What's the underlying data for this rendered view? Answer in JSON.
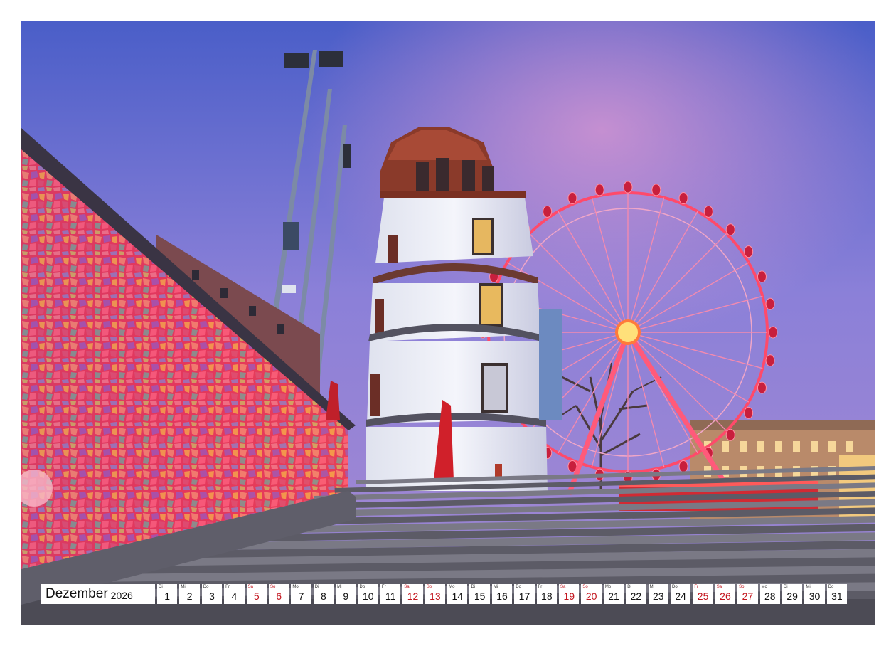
{
  "calendar": {
    "month": "Dezember",
    "year": "2026",
    "days": [
      {
        "dow": "Di",
        "num": "1",
        "red": false
      },
      {
        "dow": "Mi",
        "num": "2",
        "red": false
      },
      {
        "dow": "Do",
        "num": "3",
        "red": false
      },
      {
        "dow": "Fr",
        "num": "4",
        "red": false
      },
      {
        "dow": "Sa",
        "num": "5",
        "red": true
      },
      {
        "dow": "So",
        "num": "6",
        "red": true
      },
      {
        "dow": "Mo",
        "num": "7",
        "red": false
      },
      {
        "dow": "Di",
        "num": "8",
        "red": false
      },
      {
        "dow": "Mi",
        "num": "9",
        "red": false
      },
      {
        "dow": "Do",
        "num": "10",
        "red": false
      },
      {
        "dow": "Fr",
        "num": "11",
        "red": false
      },
      {
        "dow": "Sa",
        "num": "12",
        "red": true
      },
      {
        "dow": "So",
        "num": "13",
        "red": true
      },
      {
        "dow": "Mo",
        "num": "14",
        "red": false
      },
      {
        "dow": "Di",
        "num": "15",
        "red": false
      },
      {
        "dow": "Mi",
        "num": "16",
        "red": false
      },
      {
        "dow": "Do",
        "num": "17",
        "red": false
      },
      {
        "dow": "Fr",
        "num": "18",
        "red": false
      },
      {
        "dow": "Sa",
        "num": "19",
        "red": true
      },
      {
        "dow": "So",
        "num": "20",
        "red": true
      },
      {
        "dow": "Mo",
        "num": "21",
        "red": false
      },
      {
        "dow": "Di",
        "num": "22",
        "red": false
      },
      {
        "dow": "Mi",
        "num": "23",
        "red": false
      },
      {
        "dow": "Do",
        "num": "24",
        "red": false
      },
      {
        "dow": "Fr",
        "num": "25",
        "red": true
      },
      {
        "dow": "Sa",
        "num": "26",
        "red": true
      },
      {
        "dow": "So",
        "num": "27",
        "red": true
      },
      {
        "dow": "Mo",
        "num": "28",
        "red": false
      },
      {
        "dow": "Di",
        "num": "29",
        "red": false
      },
      {
        "dow": "Mi",
        "num": "30",
        "red": false
      },
      {
        "dow": "Do",
        "num": "31",
        "red": false
      }
    ]
  },
  "colors": {
    "sky_top": "#4f63c9",
    "sky_mid": "#8a7fd6",
    "sky_glow": "#d58bd0",
    "mosaic_red": "#e8325a",
    "wheel_red": "#ff3355",
    "tower_white": "#eef0f6",
    "tower_roof": "#8a3a2a",
    "stairs": "#6d6f7a",
    "holiday_red": "#c3141d"
  }
}
